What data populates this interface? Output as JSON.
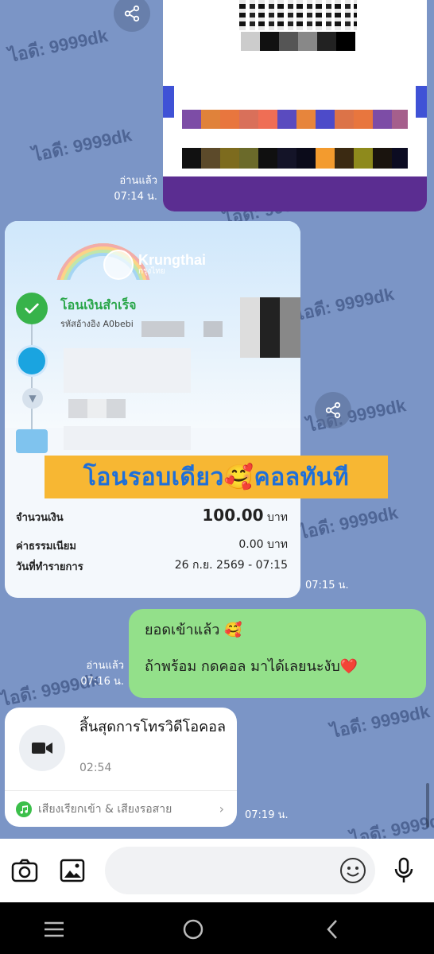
{
  "watermark": "ไอดี: 9999dk",
  "qr_message": {
    "read": "อ่านแล้ว",
    "time": "07:14 น."
  },
  "receipt": {
    "bank_name": "Krungthai",
    "bank_name_th": "กรุงไทย",
    "status": "โอนเงินสำเร็จ",
    "reference": "รหัสอ้างอิง A0bebi",
    "banner_text": "โอนรอบเดียว🥰คอลทันที",
    "amount_label": "จำนวนเงิน",
    "amount_value": "100.00",
    "amount_unit": "บาท",
    "fee_label": "ค่าธรรมเนียม",
    "fee_value": "0.00 บาท",
    "date_label": "วันที่ทำรายการ",
    "date_value": "26 ก.ย. 2569 - 07:15",
    "time": "07:15 น."
  },
  "outgoing": {
    "line1": "ยอดเข้าแล้ว 🥰",
    "line2": "ถ้าพร้อม กดคอล มาได้เลยนะงับ❤️",
    "read": "อ่านแล้ว",
    "time": "07:16 น."
  },
  "call": {
    "title": "สิ้นสุดการโทรวิดีโอคอล",
    "duration": "02:54",
    "footer": "เสียงเรียกเข้า & เสียงรอสาย",
    "time": "07:19 น."
  },
  "colors": {
    "chat_bg": "#7b95c6",
    "bubble_green": "#93e08a",
    "banner": "#f7b733",
    "banner_text": "#1e6fd9",
    "success": "#2aa64a"
  },
  "icons": [
    "share-icon",
    "camera-icon",
    "image-icon",
    "emoji-icon",
    "mic-icon",
    "video-icon",
    "music-note-icon",
    "chevron-right-icon",
    "nav-menu-icon",
    "nav-home-icon",
    "nav-back-icon"
  ]
}
